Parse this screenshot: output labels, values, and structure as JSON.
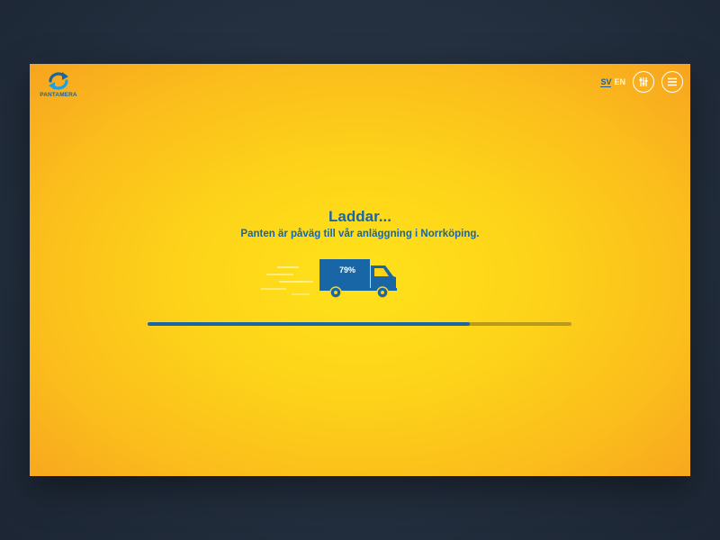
{
  "header": {
    "logo_text": "PANTAMERA",
    "lang_active": "SV",
    "lang_inactive": "EN"
  },
  "loader": {
    "title": "Laddar...",
    "subtitle": "Panten är påväg till vår anläggning i Norrköping.",
    "percent_label": "79%",
    "progress_fraction": 0.76
  },
  "icons": {
    "logo": "recycle-arrows-icon",
    "filter": "sliders-icon",
    "menu": "hamburger-menu-icon",
    "truck": "truck-icon"
  },
  "colors": {
    "brand_blue": "#1866a6",
    "background_yellow": "#fdd319",
    "page_dark": "#243040",
    "track": "#b79a1e"
  }
}
